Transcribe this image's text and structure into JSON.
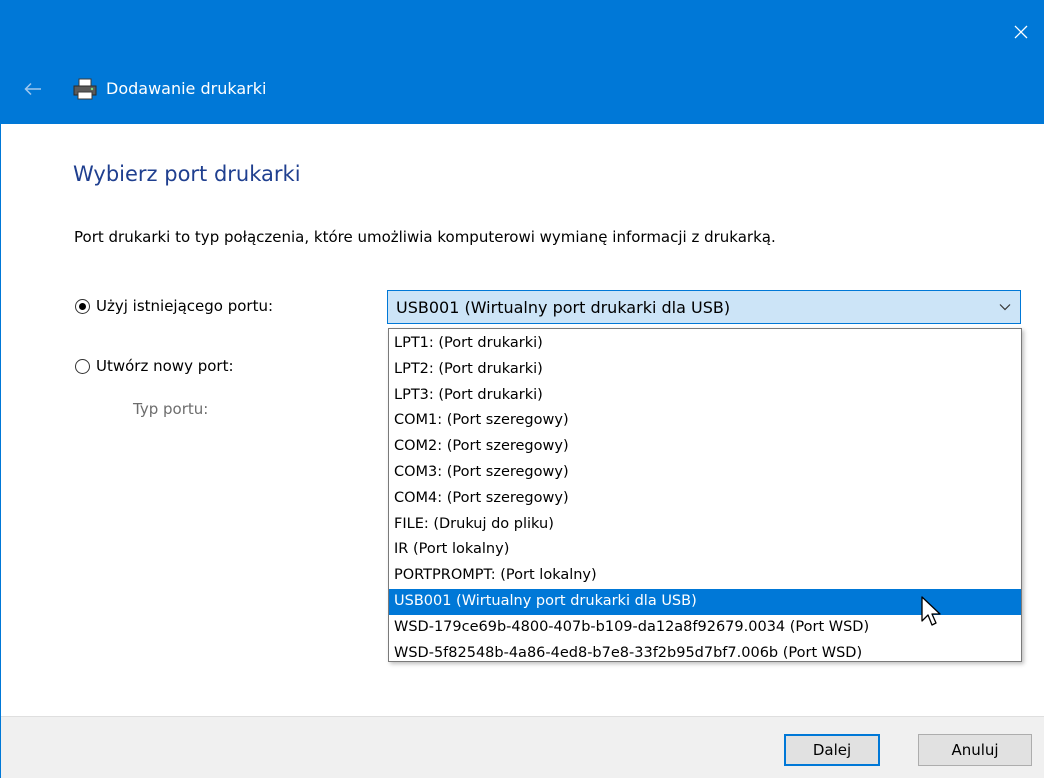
{
  "window": {
    "title": "Dodawanie drukarki",
    "accent_color": "#0078d7",
    "icons": {
      "close": "close-icon",
      "back": "back-arrow-icon",
      "title": "printer-icon"
    }
  },
  "page": {
    "heading": "Wybierz port drukarki",
    "description": "Port drukarki to typ połączenia, które umożliwia komputerowi wymianę informacji z drukarką."
  },
  "options": {
    "existing_port_label": "Użyj istniejącego portu:",
    "new_port_label": "Utwórz nowy port:",
    "port_type_label": "Typ portu:",
    "selected_option": "existing_port"
  },
  "combo": {
    "value": "USB001 (Wirtualny port drukarki dla USB)",
    "arrow_icon": "chevron-down-icon",
    "items": [
      "LPT1: (Port drukarki)",
      "LPT2: (Port drukarki)",
      "LPT3: (Port drukarki)",
      "COM1: (Port szeregowy)",
      "COM2: (Port szeregowy)",
      "COM3: (Port szeregowy)",
      "COM4: (Port szeregowy)",
      "FILE: (Drukuj do pliku)",
      "IR (Port lokalny)",
      "PORTPROMPT: (Port lokalny)",
      "USB001 (Wirtualny port drukarki dla USB)",
      "WSD-179ce69b-4800-407b-b109-da12a8f92679.0034 (Port WSD)",
      "WSD-5f82548b-4a86-4ed8-b7e8-33f2b95d7bf7.006b (Port WSD)"
    ],
    "highlighted_item": "USB001 (Wirtualny port drukarki dla USB)",
    "highlight_color": "#0078d7"
  },
  "buttons": {
    "next": "Dalej",
    "cancel": "Anuluj"
  }
}
